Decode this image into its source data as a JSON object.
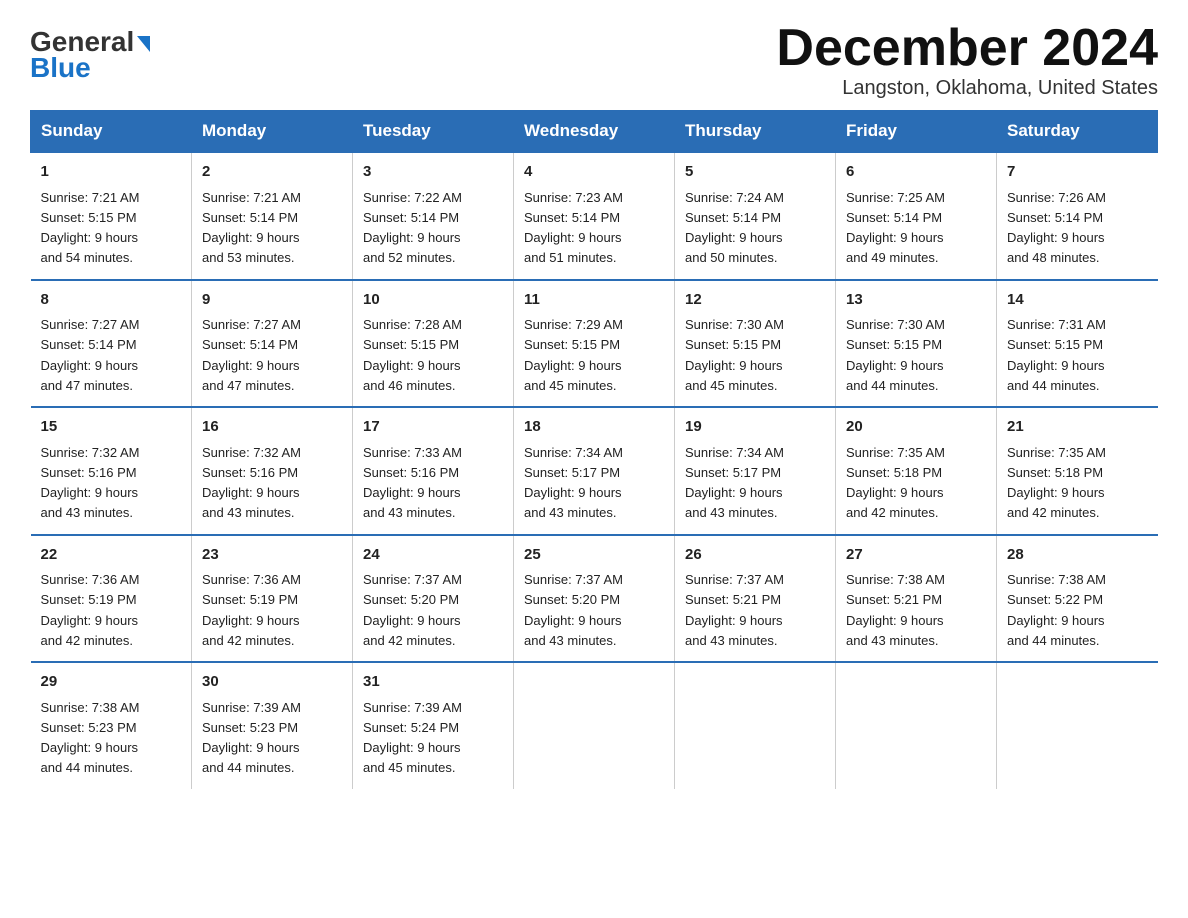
{
  "header": {
    "logo_text_general": "General",
    "logo_text_blue": "Blue",
    "title": "December 2024",
    "subtitle": "Langston, Oklahoma, United States"
  },
  "calendar": {
    "days_of_week": [
      "Sunday",
      "Monday",
      "Tuesday",
      "Wednesday",
      "Thursday",
      "Friday",
      "Saturday"
    ],
    "weeks": [
      [
        {
          "day": "1",
          "sunrise": "7:21 AM",
          "sunset": "5:15 PM",
          "daylight": "9 hours and 54 minutes."
        },
        {
          "day": "2",
          "sunrise": "7:21 AM",
          "sunset": "5:14 PM",
          "daylight": "9 hours and 53 minutes."
        },
        {
          "day": "3",
          "sunrise": "7:22 AM",
          "sunset": "5:14 PM",
          "daylight": "9 hours and 52 minutes."
        },
        {
          "day": "4",
          "sunrise": "7:23 AM",
          "sunset": "5:14 PM",
          "daylight": "9 hours and 51 minutes."
        },
        {
          "day": "5",
          "sunrise": "7:24 AM",
          "sunset": "5:14 PM",
          "daylight": "9 hours and 50 minutes."
        },
        {
          "day": "6",
          "sunrise": "7:25 AM",
          "sunset": "5:14 PM",
          "daylight": "9 hours and 49 minutes."
        },
        {
          "day": "7",
          "sunrise": "7:26 AM",
          "sunset": "5:14 PM",
          "daylight": "9 hours and 48 minutes."
        }
      ],
      [
        {
          "day": "8",
          "sunrise": "7:27 AM",
          "sunset": "5:14 PM",
          "daylight": "9 hours and 47 minutes."
        },
        {
          "day": "9",
          "sunrise": "7:27 AM",
          "sunset": "5:14 PM",
          "daylight": "9 hours and 47 minutes."
        },
        {
          "day": "10",
          "sunrise": "7:28 AM",
          "sunset": "5:15 PM",
          "daylight": "9 hours and 46 minutes."
        },
        {
          "day": "11",
          "sunrise": "7:29 AM",
          "sunset": "5:15 PM",
          "daylight": "9 hours and 45 minutes."
        },
        {
          "day": "12",
          "sunrise": "7:30 AM",
          "sunset": "5:15 PM",
          "daylight": "9 hours and 45 minutes."
        },
        {
          "day": "13",
          "sunrise": "7:30 AM",
          "sunset": "5:15 PM",
          "daylight": "9 hours and 44 minutes."
        },
        {
          "day": "14",
          "sunrise": "7:31 AM",
          "sunset": "5:15 PM",
          "daylight": "9 hours and 44 minutes."
        }
      ],
      [
        {
          "day": "15",
          "sunrise": "7:32 AM",
          "sunset": "5:16 PM",
          "daylight": "9 hours and 43 minutes."
        },
        {
          "day": "16",
          "sunrise": "7:32 AM",
          "sunset": "5:16 PM",
          "daylight": "9 hours and 43 minutes."
        },
        {
          "day": "17",
          "sunrise": "7:33 AM",
          "sunset": "5:16 PM",
          "daylight": "9 hours and 43 minutes."
        },
        {
          "day": "18",
          "sunrise": "7:34 AM",
          "sunset": "5:17 PM",
          "daylight": "9 hours and 43 minutes."
        },
        {
          "day": "19",
          "sunrise": "7:34 AM",
          "sunset": "5:17 PM",
          "daylight": "9 hours and 43 minutes."
        },
        {
          "day": "20",
          "sunrise": "7:35 AM",
          "sunset": "5:18 PM",
          "daylight": "9 hours and 42 minutes."
        },
        {
          "day": "21",
          "sunrise": "7:35 AM",
          "sunset": "5:18 PM",
          "daylight": "9 hours and 42 minutes."
        }
      ],
      [
        {
          "day": "22",
          "sunrise": "7:36 AM",
          "sunset": "5:19 PM",
          "daylight": "9 hours and 42 minutes."
        },
        {
          "day": "23",
          "sunrise": "7:36 AM",
          "sunset": "5:19 PM",
          "daylight": "9 hours and 42 minutes."
        },
        {
          "day": "24",
          "sunrise": "7:37 AM",
          "sunset": "5:20 PM",
          "daylight": "9 hours and 42 minutes."
        },
        {
          "day": "25",
          "sunrise": "7:37 AM",
          "sunset": "5:20 PM",
          "daylight": "9 hours and 43 minutes."
        },
        {
          "day": "26",
          "sunrise": "7:37 AM",
          "sunset": "5:21 PM",
          "daylight": "9 hours and 43 minutes."
        },
        {
          "day": "27",
          "sunrise": "7:38 AM",
          "sunset": "5:21 PM",
          "daylight": "9 hours and 43 minutes."
        },
        {
          "day": "28",
          "sunrise": "7:38 AM",
          "sunset": "5:22 PM",
          "daylight": "9 hours and 44 minutes."
        }
      ],
      [
        {
          "day": "29",
          "sunrise": "7:38 AM",
          "sunset": "5:23 PM",
          "daylight": "9 hours and 44 minutes."
        },
        {
          "day": "30",
          "sunrise": "7:39 AM",
          "sunset": "5:23 PM",
          "daylight": "9 hours and 44 minutes."
        },
        {
          "day": "31",
          "sunrise": "7:39 AM",
          "sunset": "5:24 PM",
          "daylight": "9 hours and 45 minutes."
        },
        null,
        null,
        null,
        null
      ]
    ],
    "labels": {
      "sunrise": "Sunrise:",
      "sunset": "Sunset:",
      "daylight": "Daylight:"
    }
  }
}
